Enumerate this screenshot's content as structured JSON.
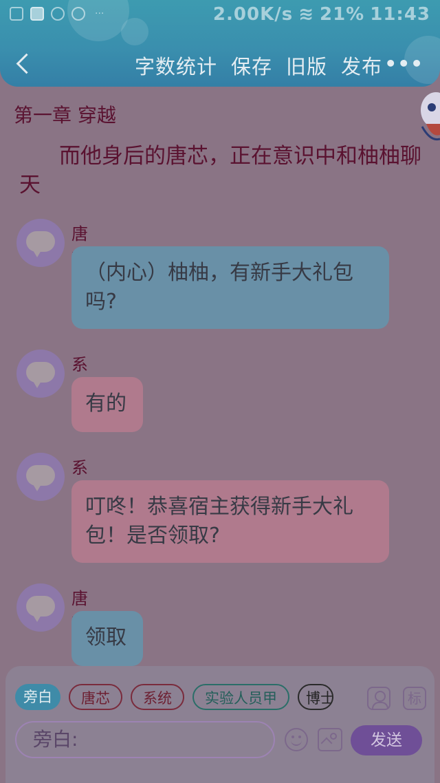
{
  "statusbar": {
    "network_speed": "2.00K/s",
    "battery": "21%",
    "time": "11:43"
  },
  "toolbar": {
    "word_count": "字数统计",
    "save": "保存",
    "old_version": "旧版",
    "publish": "发布",
    "more": "•••"
  },
  "chapter": {
    "title": "第一章 穿越",
    "narration": "而他身后的唐芯，正在意识中和柚柚聊天"
  },
  "messages": [
    {
      "speaker": "唐芯",
      "text": "（内心）柚柚，有新手大礼包吗?",
      "color": "#6990a7"
    },
    {
      "speaker": "系统",
      "text": "有的",
      "color": "#b07a8d"
    },
    {
      "speaker": "系统",
      "text": "叮咚！恭喜宿主获得新手大礼包！是否领取?",
      "color": "#b07a8d"
    },
    {
      "speaker": "唐芯",
      "text": "领取",
      "color": "#6990a7"
    }
  ],
  "composer": {
    "chips": [
      "旁白",
      "唐芯",
      "系统",
      "实验人员甲",
      "博士"
    ],
    "mark_label": "标",
    "input_value": "旁白:",
    "send_label": "发送"
  }
}
